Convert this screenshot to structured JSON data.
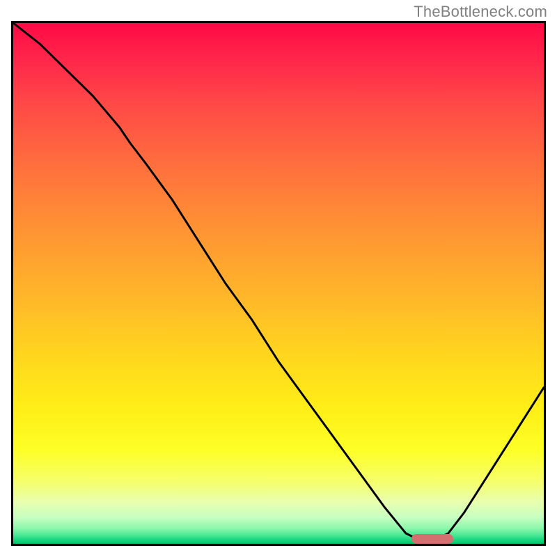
{
  "watermark": "TheBottleneck.com",
  "chart_data": {
    "type": "line",
    "title": "",
    "xlabel": "",
    "ylabel": "",
    "xlim": [
      0,
      100
    ],
    "ylim": [
      0,
      100
    ],
    "grid": false,
    "axes_visible": false,
    "series": [
      {
        "name": "bottleneck-curve",
        "x": [
          0,
          5,
          10,
          15,
          20,
          22,
          25,
          30,
          35,
          40,
          45,
          50,
          55,
          60,
          65,
          70,
          74,
          76,
          80,
          82,
          85,
          90,
          95,
          100
        ],
        "y": [
          100,
          96,
          91,
          86,
          80,
          77,
          73,
          66,
          58,
          50,
          43,
          35,
          28,
          21,
          14,
          7,
          2,
          1,
          1,
          2,
          6,
          14,
          22,
          30
        ]
      }
    ],
    "marker": {
      "name": "highlight-range",
      "x_start": 75,
      "x_end": 83,
      "y": 1,
      "color": "#d57070"
    },
    "background_gradient": {
      "stops": [
        {
          "pos": 0,
          "color": "#ff0a46"
        },
        {
          "pos": 0.27,
          "color": "#ff6e3e"
        },
        {
          "pos": 0.52,
          "color": "#ffb52a"
        },
        {
          "pos": 0.74,
          "color": "#ffee17"
        },
        {
          "pos": 0.88,
          "color": "#f6ff6a"
        },
        {
          "pos": 0.97,
          "color": "#8cf7ab"
        },
        {
          "pos": 1.0,
          "color": "#00c86a"
        }
      ]
    }
  }
}
